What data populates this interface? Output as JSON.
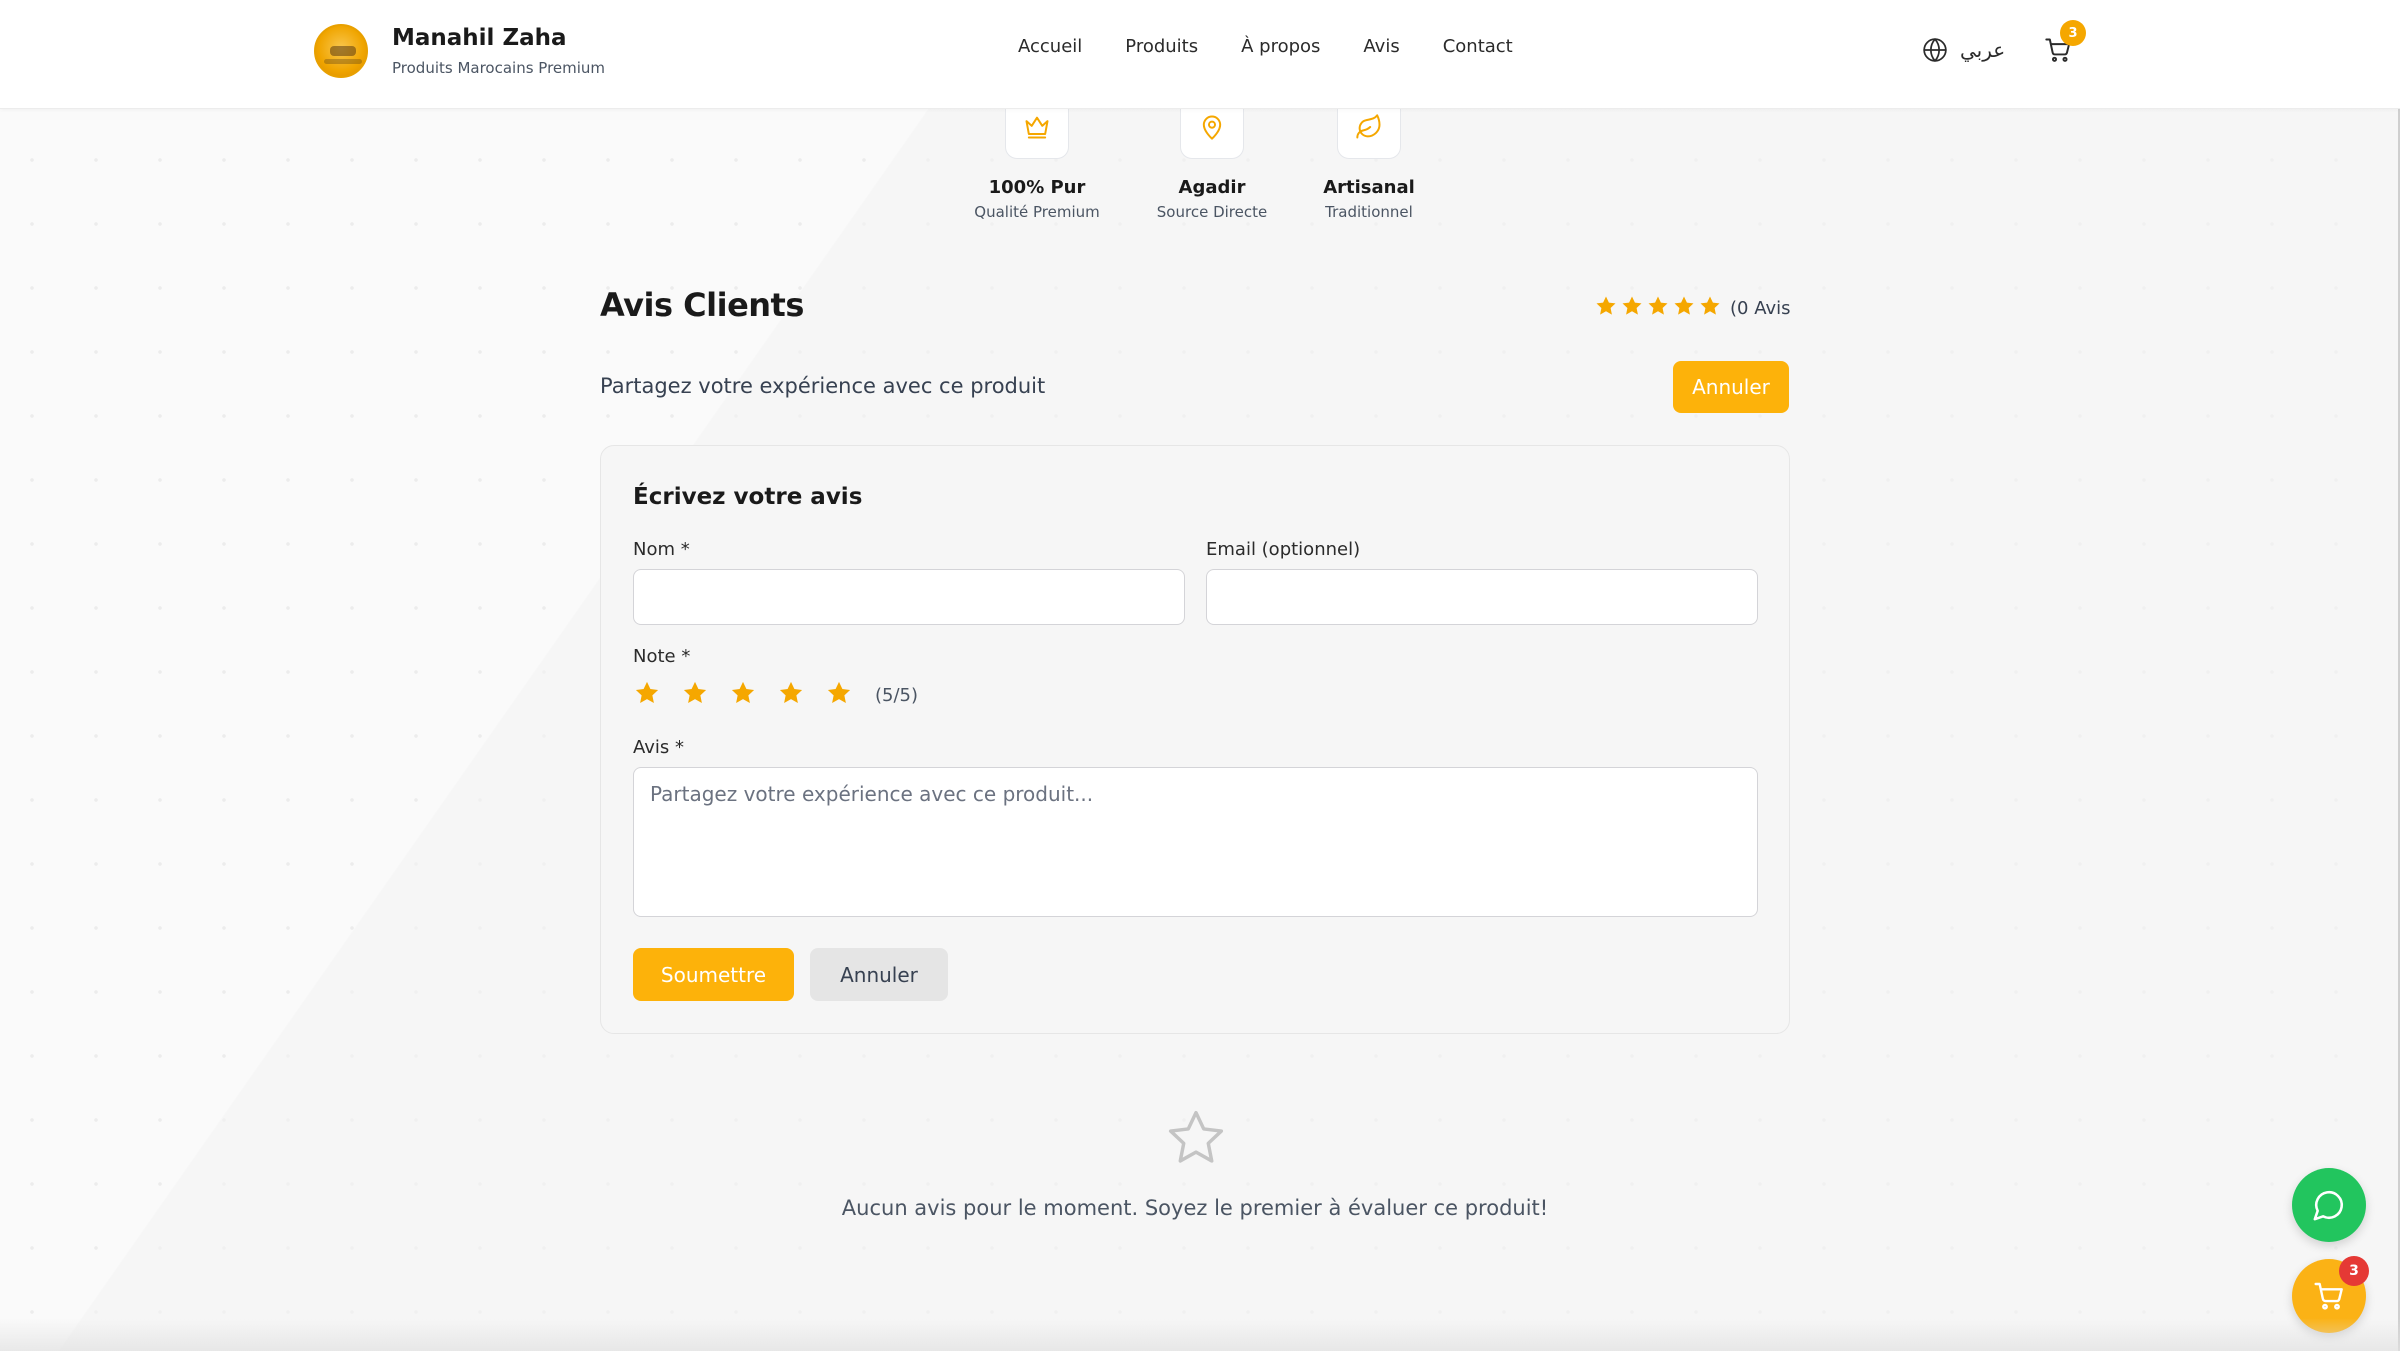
{
  "header": {
    "brand_name": "Manahil Zaha",
    "brand_tagline": "Produits Marocains Premium",
    "nav": [
      "Accueil",
      "Produits",
      "À propos",
      "Avis",
      "Contact"
    ],
    "language_label": "عربي",
    "cart_count": "3"
  },
  "features": [
    {
      "title": "100% Pur",
      "subtitle": "Qualité Premium",
      "icon": "crown-icon"
    },
    {
      "title": "Agadir",
      "subtitle": "Source Directe",
      "icon": "map-pin-icon"
    },
    {
      "title": "Artisanal",
      "subtitle": "Traditionnel",
      "icon": "leaf-icon"
    }
  ],
  "reviews": {
    "title": "Avis Clients",
    "summary_rating": 5,
    "count_label": "(0 Avis",
    "share_prompt": "Partagez votre expérience avec ce produit",
    "toggle_button": "Annuler"
  },
  "form": {
    "title": "Écrivez votre avis",
    "name_label": "Nom *",
    "name_value": "",
    "email_label": "Email (optionnel)",
    "email_value": "",
    "rating_label": "Note *",
    "rating": 5,
    "rating_text": "(5/5)",
    "review_label": "Avis *",
    "review_placeholder": "Partagez votre expérience avec ce produit...",
    "submit_label": "Soumettre",
    "cancel_label": "Annuler"
  },
  "empty_state": {
    "message": "Aucun avis pour le moment. Soyez le premier à évaluer ce produit!"
  },
  "floating": {
    "chat_icon": "chat-bubble-icon",
    "cart_icon": "cart-icon",
    "cart_count": "3"
  },
  "colors": {
    "accent": "#fdb20a",
    "star": "#f5a700",
    "whatsapp": "#22c55e",
    "badge_red": "#e53935"
  }
}
